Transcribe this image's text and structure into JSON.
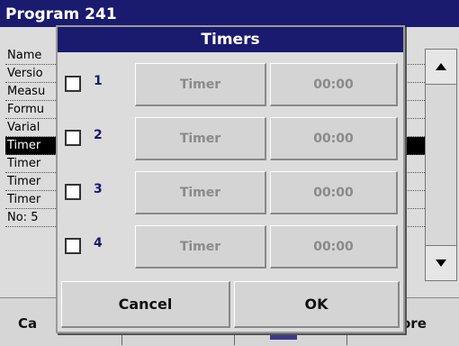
{
  "background": {
    "title": "Program   241",
    "rows": [
      "Name",
      "Versio",
      "Measu",
      "Formu",
      "Varial",
      "Timer",
      "Timer",
      "Timer",
      "Timer",
      "No: 5"
    ],
    "selected_row_index": 5,
    "bottom_left_label": "Ca",
    "bottom_right_label": "ore"
  },
  "dialog": {
    "title": "Timers",
    "timers": [
      {
        "number": "1",
        "label": "Timer",
        "time": "00:00",
        "checked": false
      },
      {
        "number": "2",
        "label": "Timer",
        "time": "00:00",
        "checked": false
      },
      {
        "number": "3",
        "label": "Timer",
        "time": "00:00",
        "checked": false
      },
      {
        "number": "4",
        "label": "Timer",
        "time": "00:00",
        "checked": false
      }
    ],
    "cancel_label": "Cancel",
    "ok_label": "OK"
  },
  "icons": {
    "scroll_up": "scroll-up-arrow-icon",
    "scroll_down": "scroll-down-arrow-icon"
  },
  "colors": {
    "title_bar": "#1a1a6e",
    "number_text": "#1a1a6e",
    "disabled_text": "#8a8a8a"
  }
}
